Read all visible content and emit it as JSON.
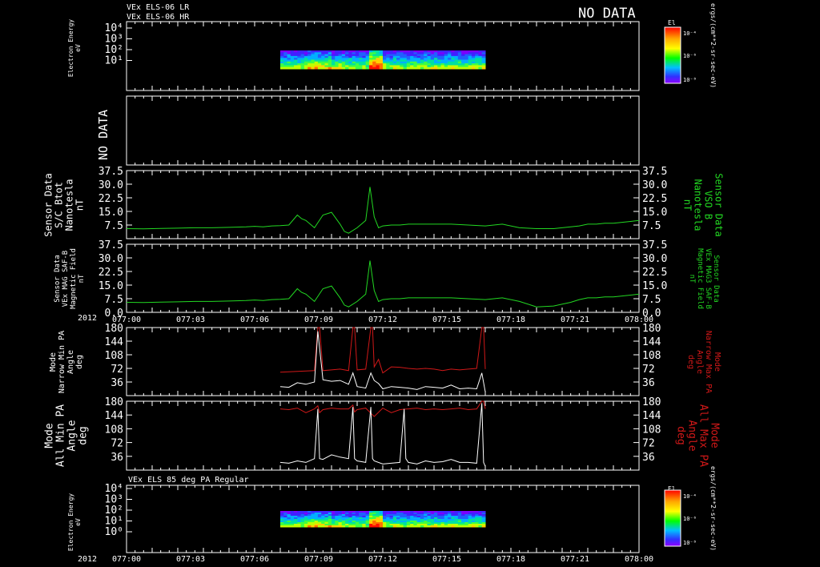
{
  "header": {
    "line1": "VEx ELS-06 LR",
    "line2": "VEx ELS-06 HR",
    "no_data_top": "NO DATA"
  },
  "colorbar": {
    "label": "El",
    "unit_top": "ergs/(cm**2-sr-sec-eV)",
    "unit_bottom": "ergs/(cm**2-sr-sec-eV)",
    "ticks": [
      "10⁻⁴",
      "10⁻⁶",
      "10⁻⁸"
    ]
  },
  "time_axis": {
    "year": "2012",
    "ticks": [
      "077:00",
      "077:03",
      "077:06",
      "077:09",
      "077:12",
      "077:15",
      "077:18",
      "077:21",
      "078:00"
    ]
  },
  "colors": {
    "background": "#000000",
    "axes": "#ffffff",
    "green": "#22d822",
    "red": "#d01818",
    "white": "#ffffff"
  },
  "chart_data": [
    {
      "type": "heatmap",
      "ylabel_lines": [
        "Electron Energy",
        "eV"
      ],
      "y_ticks": [
        "10⁴",
        "10³",
        "10²",
        "10¹"
      ],
      "x_range_minutes": [
        0,
        60
      ],
      "data_span_minutes": [
        18,
        42
      ],
      "log_y": true
    },
    {
      "type": "heatmap",
      "no_data_text": "NO DATA"
    },
    {
      "type": "line",
      "ylabel_lines": [
        "Sensor Data",
        "S/C Btot",
        "Nanotesla",
        "nT"
      ],
      "right_label_lines": [
        "Sensor Data",
        "VSO B",
        "Nanotesla",
        "nT"
      ],
      "y_ticks": [
        "37.5",
        "30.0",
        "22.5",
        "15.0",
        "7.5"
      ],
      "ylim": [
        0,
        37.5
      ],
      "series": [
        {
          "x": [
            0,
            2,
            4,
            6,
            8,
            10,
            12,
            14,
            15,
            16,
            17,
            18,
            19,
            20,
            20.5,
            21,
            22,
            23,
            24,
            25,
            25.5,
            26,
            27,
            28,
            28.5,
            29,
            29.5,
            30,
            31,
            32,
            33,
            35,
            38,
            40,
            42,
            44,
            46,
            48,
            50,
            52,
            53,
            54,
            55,
            56,
            57,
            58,
            59,
            60
          ],
          "y": [
            5.5,
            5.4,
            5.6,
            5.8,
            6.0,
            6.0,
            6.2,
            6.5,
            6.8,
            6.5,
            7.0,
            7.2,
            7.5,
            13.0,
            11.0,
            10.0,
            6.0,
            13.0,
            14.5,
            8.0,
            4.0,
            3.0,
            6.0,
            10.0,
            28.5,
            12.0,
            6.0,
            7.0,
            7.5,
            7.5,
            8.0,
            8.0,
            8.0,
            7.5,
            7.0,
            8.0,
            6.0,
            5.5,
            5.5,
            6.5,
            7.0,
            8.0,
            8.0,
            8.5,
            8.5,
            9.0,
            9.5,
            10.0
          ]
        }
      ]
    },
    {
      "type": "line",
      "ylabel_lines": [
        "Sensor Data",
        "VEx MAG SAF-B",
        "Magnetic Field",
        "nT"
      ],
      "right_label_lines": [
        "Sensor Data",
        "VEx MAG3 SAF-B",
        "Magnetic Field",
        "nT"
      ],
      "y_ticks": [
        "37.5",
        "30.0",
        "22.5",
        "15.0",
        "7.5",
        "0.0"
      ],
      "ylim": [
        0,
        37.5
      ],
      "series": [
        {
          "x": [
            0,
            2,
            4,
            6,
            8,
            10,
            12,
            14,
            15,
            16,
            17,
            18,
            19,
            20,
            20.5,
            21,
            22,
            23,
            24,
            25,
            25.5,
            26,
            27,
            28,
            28.5,
            29,
            29.5,
            30,
            31,
            32,
            33,
            35,
            38,
            40,
            42,
            44,
            46,
            48,
            50,
            52,
            53,
            54,
            55,
            56,
            57,
            58,
            59,
            60
          ],
          "y": [
            5.5,
            5.4,
            5.6,
            5.8,
            6.0,
            6.0,
            6.2,
            6.5,
            6.8,
            6.5,
            7.0,
            7.2,
            7.5,
            13.0,
            11.0,
            10.0,
            6.0,
            13.0,
            14.5,
            8.0,
            4.0,
            3.0,
            6.0,
            10.0,
            28.5,
            12.0,
            6.0,
            7.0,
            7.5,
            7.5,
            8.0,
            8.0,
            8.0,
            7.5,
            7.0,
            8.0,
            6.0,
            3.0,
            3.5,
            5.5,
            7.0,
            8.0,
            8.0,
            8.5,
            8.5,
            9.0,
            9.5,
            10.0
          ]
        }
      ]
    },
    {
      "type": "line",
      "ylabel_lines": [
        "Mode",
        "Narrow Min PA",
        "Angle",
        "deg"
      ],
      "right_label_lines": [
        "Mode",
        "Narrow Max PA",
        "Angle",
        "deg"
      ],
      "y_ticks": [
        "180",
        "144",
        "108",
        "72",
        "36"
      ],
      "ylim": [
        0,
        180
      ],
      "series": [
        {
          "color": "red",
          "x": [
            18,
            19,
            20,
            21,
            22,
            22.4,
            22.6,
            23,
            24,
            25,
            26,
            26.5,
            26.7,
            27,
            28,
            28.6,
            28.8,
            29,
            29.5,
            30,
            31,
            32,
            33,
            34,
            35,
            36,
            37,
            38,
            39,
            40,
            41,
            41.6,
            41.8,
            42
          ],
          "x_note": "minutes",
          "y": [
            62,
            63,
            64,
            65,
            66,
            180,
            180,
            66,
            68,
            70,
            66,
            180,
            180,
            68,
            70,
            180,
            180,
            76,
            96,
            60,
            76,
            75,
            72,
            70,
            72,
            70,
            66,
            70,
            68,
            70,
            72,
            180,
            180,
            70
          ]
        },
        {
          "color": "white",
          "x": [
            18,
            19,
            20,
            21,
            22,
            22.4,
            23,
            24,
            25,
            26,
            26.5,
            27,
            28,
            28.6,
            29,
            29.5,
            30,
            31,
            32,
            33,
            34,
            35,
            36,
            37,
            38,
            39,
            40,
            41,
            41.6,
            42
          ],
          "y": [
            24,
            22,
            34,
            30,
            36,
            170,
            42,
            38,
            40,
            30,
            60,
            24,
            20,
            60,
            40,
            32,
            18,
            24,
            22,
            20,
            16,
            24,
            22,
            20,
            28,
            18,
            20,
            18,
            60,
            10
          ]
        }
      ]
    },
    {
      "type": "line",
      "ylabel_lines": [
        "Mode",
        "All Min PA",
        "Angle",
        "deg"
      ],
      "right_label_lines": [
        "Mode",
        "All Max PA",
        "Angle",
        "deg"
      ],
      "y_ticks": [
        "180",
        "144",
        "108",
        "72",
        "36"
      ],
      "ylim": [
        0,
        180
      ],
      "series": [
        {
          "color": "red",
          "x": [
            18,
            19,
            20,
            21,
            22,
            22.4,
            22.6,
            23,
            24,
            25,
            26,
            26.5,
            26.7,
            27,
            28,
            29,
            30,
            31,
            32,
            33,
            34,
            35,
            36,
            37,
            38,
            39,
            40,
            41,
            41.6,
            41.8,
            42
          ],
          "y": [
            160,
            158,
            162,
            150,
            160,
            168,
            150,
            158,
            162,
            160,
            160,
            170,
            152,
            158,
            162,
            140,
            162,
            150,
            158,
            160,
            162,
            158,
            160,
            158,
            160,
            162,
            158,
            160,
            180,
            180,
            160
          ],
          "x_note": "minutes"
        },
        {
          "color": "white",
          "x": [
            18,
            19,
            20,
            21,
            22,
            22.4,
            22.6,
            23,
            24,
            25,
            26,
            26.5,
            26.7,
            27,
            28,
            28.6,
            28.8,
            29,
            30,
            31,
            32,
            32.5,
            32.7,
            33,
            34,
            35,
            36,
            37,
            38,
            39,
            40,
            41,
            41.6,
            41.8,
            42
          ],
          "y": [
            20,
            18,
            24,
            20,
            30,
            160,
            30,
            28,
            40,
            34,
            30,
            165,
            30,
            24,
            20,
            165,
            30,
            24,
            16,
            18,
            20,
            160,
            30,
            20,
            16,
            24,
            20,
            22,
            28,
            20,
            20,
            18,
            175,
            20,
            10
          ]
        }
      ]
    },
    {
      "type": "heatmap",
      "title": "VEx ELS 85 deg PA Regular",
      "ylabel_lines": [
        "Electron Energy",
        "eV"
      ],
      "y_ticks": [
        "10⁴",
        "10³",
        "10²",
        "10¹",
        "10⁰"
      ],
      "x_range_minutes": [
        0,
        60
      ],
      "data_span_minutes": [
        18,
        42
      ],
      "log_y": true
    }
  ]
}
